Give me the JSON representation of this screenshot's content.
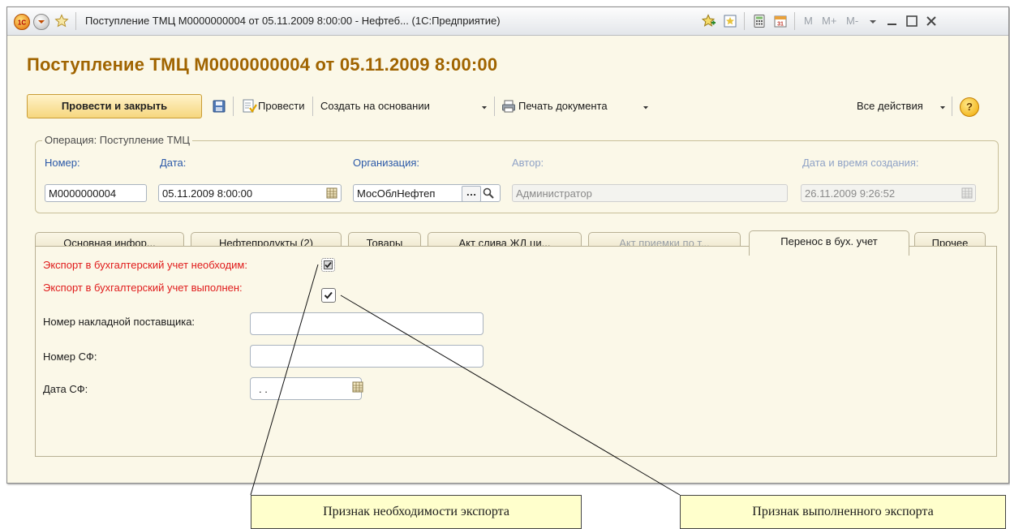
{
  "window": {
    "title": "Поступление ТМЦ М0000000004 от 05.11.2009 8:00:00 - Нефтеб... (1С:Предприятие)",
    "memory_buttons": [
      "M",
      "M+",
      "M-"
    ]
  },
  "document": {
    "title": "Поступление ТМЦ М0000000004 от 05.11.2009 8:00:00"
  },
  "toolbar": {
    "post_close_label": "Провести и закрыть",
    "post_label": "Провести",
    "create_based_label": "Создать на основании",
    "print_label": "Печать документа",
    "all_actions_label": "Все действия",
    "help_label": "?"
  },
  "header": {
    "group_label": "Операция: Поступление ТМЦ",
    "number_label": "Номер:",
    "number_value": "М0000000004",
    "date_label": "Дата:",
    "date_value": "05.11.2009  8:00:00",
    "org_label": "Организация:",
    "org_value": "МосОблНефтеп",
    "author_label": "Автор:",
    "author_value": "Администратор",
    "created_label": "Дата и время создания:",
    "created_value": "26.11.2009  9:26:52"
  },
  "tabs": [
    {
      "label": "Основная инфор...",
      "state": "normal"
    },
    {
      "label": "Нефтепродукты (2)",
      "state": "normal"
    },
    {
      "label": "Товары",
      "state": "normal"
    },
    {
      "label": "Акт слива ЖД ци...",
      "state": "normal"
    },
    {
      "label": "Акт приемки по т...",
      "state": "disabled"
    },
    {
      "label": "Перенос в бух. учет",
      "state": "active"
    },
    {
      "label": "Прочее",
      "state": "normal"
    }
  ],
  "transfer": {
    "export_required_label": "Экспорт в бухгалтерский учет необходим:",
    "export_required_checked": true,
    "export_done_label": "Экспорт в бухгалтерский учет выполнен:",
    "export_done_checked": true,
    "supplier_invoice_label": "Номер накладной поставщика:",
    "supplier_invoice_value": "",
    "sf_number_label": "Номер СФ:",
    "sf_number_value": "",
    "sf_date_label": "Дата СФ:",
    "sf_date_value": " .  . "
  },
  "callouts": {
    "export_required": "Признак необходимости экспорта",
    "export_done": "Признак выполненного экспорта"
  },
  "colors": {
    "title": "#a06400",
    "required_label": "#e01b1b",
    "field_label": "#2a58a8",
    "callout_bg": "#ffffcc"
  }
}
